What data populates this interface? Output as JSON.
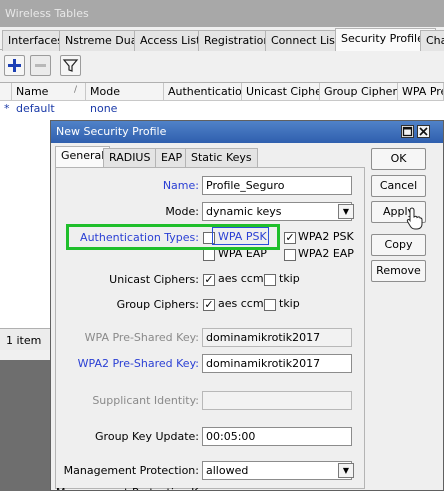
{
  "parent_window": {
    "title": "Wireless Tables",
    "tabs": [
      "Interfaces",
      "Nstreme Dual",
      "Access List",
      "Registration",
      "Connect List",
      "Security Profiles",
      "Cha"
    ],
    "active_tab": "Security Profiles",
    "columns": [
      "Name",
      "Mode",
      "Authenticatio...",
      "Unicast Ciphers",
      "Group Ciphers",
      "WPA Pre"
    ],
    "rows": [
      {
        "marker": "*",
        "name": "default",
        "mode": "none"
      }
    ],
    "status": "1 item"
  },
  "dialog": {
    "title": "New Security Profile",
    "tabs": [
      "General",
      "RADIUS",
      "EAP",
      "Static Keys"
    ],
    "active_tab": "General",
    "fields": {
      "name": {
        "label": "Name:",
        "value": "Profile_Seguro"
      },
      "mode": {
        "label": "Mode:",
        "value": "dynamic keys"
      },
      "auth_types": {
        "label": "Authentication Types:",
        "wpa_psk": "WPA PSK",
        "wpa2_psk": "WPA2 PSK",
        "wpa_eap": "WPA EAP",
        "wpa2_eap": "WPA2 EAP"
      },
      "unicast_ciphers": {
        "label": "Unicast Ciphers:",
        "aes_ccm": "aes ccm",
        "tkip": "tkip"
      },
      "group_ciphers": {
        "label": "Group Ciphers:",
        "aes_ccm": "aes ccm",
        "tkip": "tkip"
      },
      "wpa_psk_key": {
        "label": "WPA Pre-Shared Key:",
        "value": "dominamikrotik2017"
      },
      "wpa2_psk_key": {
        "label": "WPA2 Pre-Shared Key:",
        "value": "dominamikrotik2017"
      },
      "supplicant_identity": {
        "label": "Supplicant Identity:",
        "value": ""
      },
      "group_key_update": {
        "label": "Group Key Update:",
        "value": "00:05:00"
      },
      "management_protection": {
        "label": "Management Protection:",
        "value": "allowed"
      },
      "management_protection_key": {
        "label": "Management Protection Ke"
      }
    },
    "checks": {
      "wpa_psk": false,
      "wpa2_psk": true,
      "wpa_eap": false,
      "wpa2_eap": false,
      "unicast_aes": true,
      "unicast_tkip": false,
      "group_aes": true,
      "group_tkip": false
    },
    "buttons": {
      "ok": "OK",
      "cancel": "Cancel",
      "apply": "Apply",
      "copy": "Copy",
      "remove": "Remove"
    }
  },
  "colors": {
    "highlight": "#1fbf2b",
    "titlebar": "#2f5fae",
    "label_blue": "#2a3fd4"
  }
}
